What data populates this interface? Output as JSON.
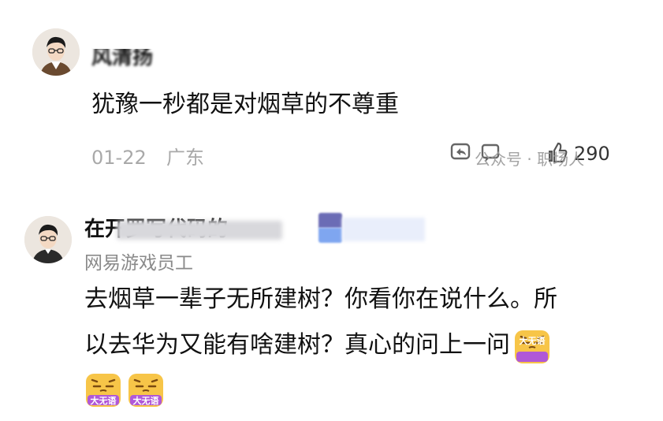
{
  "comments": [
    {
      "username": "风清扬",
      "text": "犹豫一秒都是对烟草的不尊重",
      "date": "01-22",
      "location": "广东",
      "likes": "290"
    },
    {
      "username": "在开罗写代码的",
      "subtitle": "网易游戏员工",
      "text_line1": "去烟草一辈子无所建树？你看你在说什么。所",
      "text_line2": "以去华为又能有啥建树？真心的问上一问",
      "emoji_label": "大无语"
    }
  ],
  "watermark": "公众号 · 职场人"
}
